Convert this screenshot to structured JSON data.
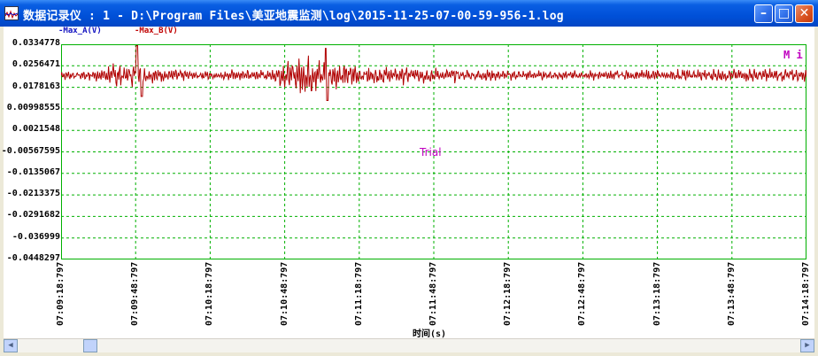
{
  "window": {
    "title": "数据记录仪 : 1 - D:\\Program Files\\美亚地震监测\\log\\2015-11-25-07-00-59-956-1.log",
    "minimize_glyph": "–",
    "maximize_glyph": "□",
    "close_glyph": "✕"
  },
  "legend": [
    {
      "label": "-Max_A(V)",
      "color": "#1010c0"
    },
    {
      "label": "-Max_B(V)",
      "color": "#c00000"
    }
  ],
  "plot_marker": "M i",
  "watermark": "Trial",
  "colors": {
    "grid": "#00b000",
    "trace": "#b00000",
    "watermark": "#c000c0"
  },
  "chart_data": {
    "type": "line",
    "xlabel": "时间(s)",
    "ylabel": "",
    "y_ticks": [
      "0.0334778",
      "0.0256471",
      "0.0178163",
      "0.00998555",
      "0.0021548",
      "-0.00567595",
      "-0.0135067",
      "-0.0213375",
      "-0.0291682",
      "-0.036999",
      "-0.0448297"
    ],
    "ylim": [
      -0.0448297,
      0.0334778
    ],
    "x_ticks": [
      "07:09:18:797",
      "07:09:48:797",
      "07:10:18:797",
      "07:10:48:797",
      "07:11:18:797",
      "07:11:48:797",
      "07:12:18:797",
      "07:12:48:797",
      "07:13:18:797",
      "07:13:48:797",
      "07:14:18:797"
    ],
    "grid": true,
    "series": [
      {
        "name": "Max_B(V)",
        "baseline": 0.0222,
        "envelope": [
          [
            0.0,
            0.0013
          ],
          [
            0.05,
            0.002
          ],
          [
            0.08,
            0.0045
          ],
          [
            0.11,
            0.003
          ],
          [
            0.14,
            0.002
          ],
          [
            0.2,
            0.0015
          ],
          [
            0.28,
            0.0022
          ],
          [
            0.33,
            0.0065
          ],
          [
            0.37,
            0.004
          ],
          [
            0.42,
            0.003
          ],
          [
            0.5,
            0.0025
          ],
          [
            0.6,
            0.0015
          ],
          [
            0.7,
            0.0015
          ],
          [
            0.8,
            0.0018
          ],
          [
            0.9,
            0.002
          ],
          [
            1.0,
            0.0022
          ]
        ],
        "spikes": [
          {
            "x": 0.102,
            "value": 0.033
          },
          {
            "x": 0.108,
            "value": 0.0145
          },
          {
            "x": 0.355,
            "value": 0.032
          },
          {
            "x": 0.357,
            "value": 0.013
          }
        ]
      }
    ]
  }
}
